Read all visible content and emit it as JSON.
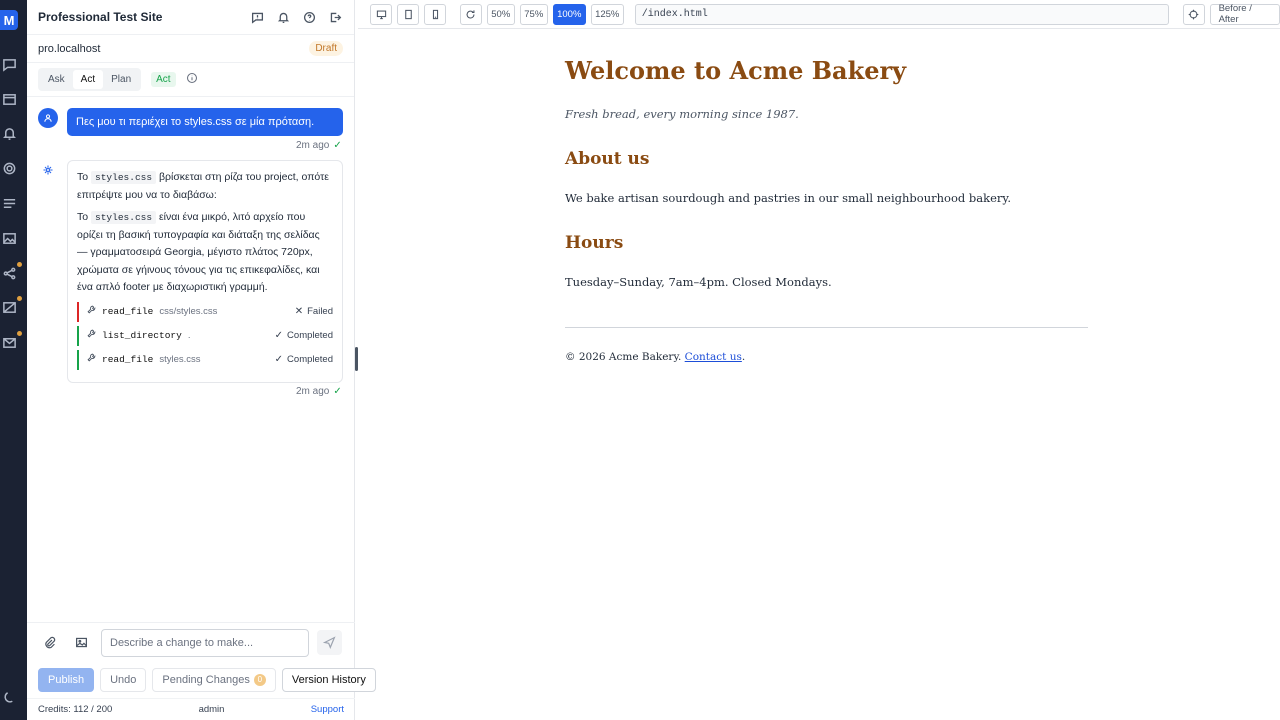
{
  "rail": {
    "logo": "M"
  },
  "panel": {
    "title": "Professional Test Site",
    "domain": "pro.localhost",
    "status": "Draft",
    "modes": [
      "Ask",
      "Act",
      "Plan"
    ],
    "active_mode": "Act"
  },
  "conversation": {
    "user_message": "Πες μου τι περιέχει το styles.css σε μία πρόταση.",
    "user_time": "2m ago",
    "assistant": {
      "p1_prefix": "Το",
      "p1_code": "styles.css",
      "p1_suffix": "βρίσκεται στη ρίζα του project, οπότε επιτρέψτε μου να το διαβάσω:",
      "p2_prefix": "Το",
      "p2_code": "styles.css",
      "p2_suffix": "είναι ένα μικρό, λιτό αρχείο που ορίζει τη βασική τυπογραφία και διάταξη της σελίδας — γραμματοσειρά Georgia, μέγιστο πλάτος 720px, χρώματα σε γήινους τόνους για τις επικεφαλίδες, και ένα απλό footer με διαχωριστική γραμμή."
    },
    "tools": [
      {
        "name": "read_file",
        "arg": "css/styles.css",
        "status": "Failed"
      },
      {
        "name": "list_directory",
        "arg": ".",
        "status": "Completed"
      },
      {
        "name": "read_file",
        "arg": "styles.css",
        "status": "Completed"
      }
    ],
    "assistant_time": "2m ago"
  },
  "composer": {
    "placeholder": "Describe a change to make..."
  },
  "actions": {
    "publish": "Publish",
    "undo": "Undo",
    "pending": "Pending Changes",
    "pending_count": "0",
    "history": "Version History"
  },
  "footer": {
    "credits": "Credits: 112 / 200",
    "user": "admin",
    "support": "Support"
  },
  "toolbar": {
    "zooms": [
      "50%",
      "75%",
      "100%",
      "125%"
    ],
    "active_zoom": "100%",
    "url": "/index.html",
    "compare": "Before / After"
  },
  "site": {
    "heading": "Welcome to Acme Bakery",
    "tagline": "Fresh bread, every morning since 1987.",
    "about_heading": "About us",
    "about_text": "We bake artisan sourdough and pastries in our small neighbourhood bakery.",
    "hours_heading": "Hours",
    "hours_text": "Tuesday–Sunday, 7am–4pm. Closed Mondays.",
    "footer_text": "© 2026 Acme Bakery.",
    "footer_link": "Contact us",
    "footer_end": "."
  },
  "colors": {
    "accent": "#2563eb",
    "heading": "#8a4b12",
    "rail": "#1b2233",
    "draft": "#c2782a",
    "success": "#16a34a",
    "fail": "#dc2626"
  }
}
